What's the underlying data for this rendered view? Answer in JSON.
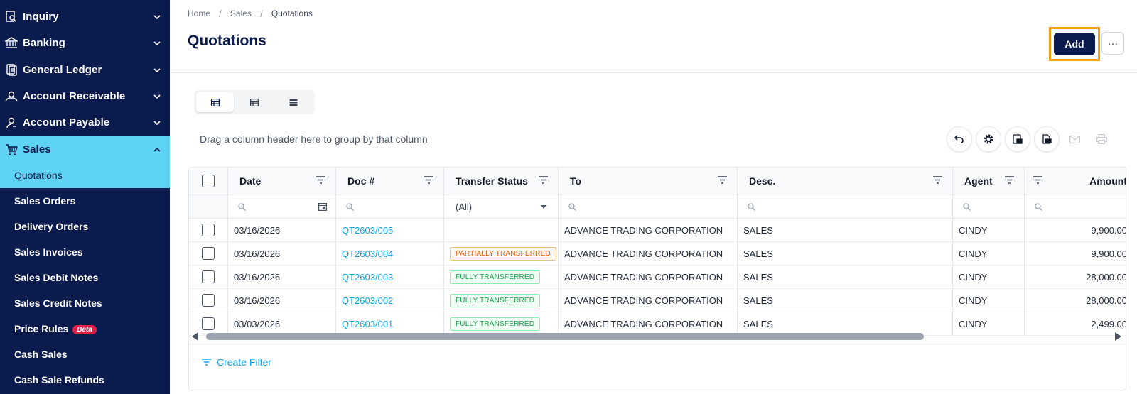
{
  "sidebar": {
    "groups": [
      {
        "label": "Inquiry",
        "icon": "search-doc-icon"
      },
      {
        "label": "Banking",
        "icon": "bank-icon"
      },
      {
        "label": "General Ledger",
        "icon": "ledger-icon"
      },
      {
        "label": "Account Receivable",
        "icon": "receivable-icon"
      },
      {
        "label": "Account Payable",
        "icon": "payable-icon"
      },
      {
        "label": "Sales",
        "icon": "cart-icon"
      }
    ],
    "sales_items": [
      {
        "label": "Quotations"
      },
      {
        "label": "Sales Orders"
      },
      {
        "label": "Delivery Orders"
      },
      {
        "label": "Sales Invoices"
      },
      {
        "label": "Sales Debit Notes"
      },
      {
        "label": "Sales Credit Notes"
      },
      {
        "label": "Price Rules",
        "badge": "Beta"
      },
      {
        "label": "Cash Sales"
      },
      {
        "label": "Cash Sale Refunds"
      }
    ]
  },
  "breadcrumb": {
    "home": "Home",
    "section": "Sales",
    "current": "Quotations",
    "sep": "/"
  },
  "page": {
    "title": "Quotations"
  },
  "header_actions": {
    "add_label": "Add",
    "more_label": "···"
  },
  "grid": {
    "group_hint": "Drag a column header here to group by that column",
    "columns": {
      "date": "Date",
      "doc": "Doc #",
      "status": "Transfer Status",
      "to": "To",
      "desc": "Desc.",
      "agent": "Agent",
      "amount": "Amount"
    },
    "status_filter_value": "(All)",
    "rows": [
      {
        "date": "03/16/2026",
        "doc": "QT2603/005",
        "status": "",
        "to": "ADVANCE TRADING CORPORATION",
        "desc": "SALES",
        "agent": "CINDY",
        "amount": "9,900.00"
      },
      {
        "date": "03/16/2026",
        "doc": "QT2603/004",
        "status": "PARTIALLY TRANSFERRED",
        "to": "ADVANCE TRADING CORPORATION",
        "desc": "SALES",
        "agent": "CINDY",
        "amount": "9,900.00"
      },
      {
        "date": "03/16/2026",
        "doc": "QT2603/003",
        "status": "FULLY TRANSFERRED",
        "to": "ADVANCE TRADING CORPORATION",
        "desc": "SALES",
        "agent": "CINDY",
        "amount": "28,000.00"
      },
      {
        "date": "03/16/2026",
        "doc": "QT2603/002",
        "status": "FULLY TRANSFERRED",
        "to": "ADVANCE TRADING CORPORATION",
        "desc": "SALES",
        "agent": "CINDY",
        "amount": "28,000.00"
      },
      {
        "date": "03/03/2026",
        "doc": "QT2603/001",
        "status": "FULLY TRANSFERRED",
        "to": "ADVANCE TRADING CORPORATION",
        "desc": "SALES",
        "agent": "CINDY",
        "amount": "2,499.00"
      }
    ],
    "create_filter_label": "Create Filter"
  },
  "colors": {
    "sidebar_bg": "#0b1b4d",
    "active_bg": "#5fd3f3",
    "link": "#0ea5e9",
    "highlight": "#f59e0b"
  }
}
